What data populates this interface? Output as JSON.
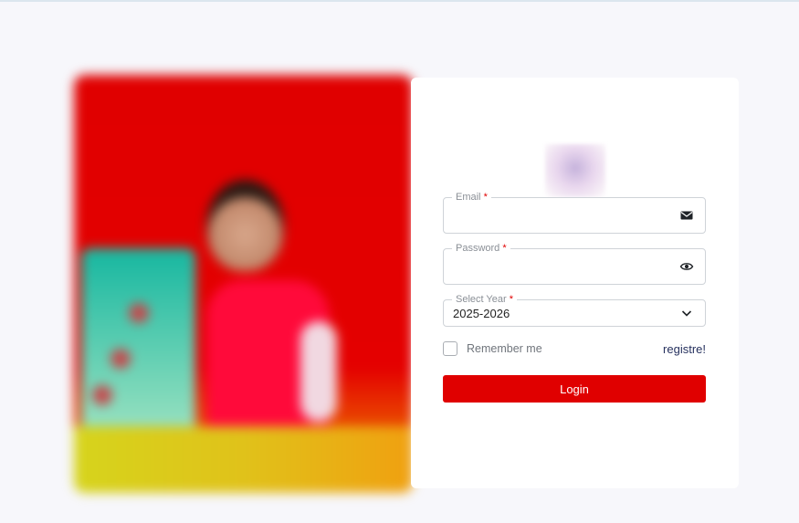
{
  "form": {
    "email": {
      "label": "Email",
      "required_mark": "*",
      "value": ""
    },
    "password": {
      "label": "Password",
      "required_mark": "*",
      "value": ""
    },
    "year": {
      "label": "Select Year",
      "required_mark": "*",
      "selected": "2025-2026"
    },
    "remember_label": "Remember me",
    "register_link": "registre!",
    "login_label": "Login"
  },
  "icons": {
    "email": "envelope-icon",
    "password": "eye-icon",
    "year": "chevron-down-icon"
  },
  "colors": {
    "accent": "#e00000",
    "link": "#27325f",
    "background": "#f7f7fb"
  }
}
